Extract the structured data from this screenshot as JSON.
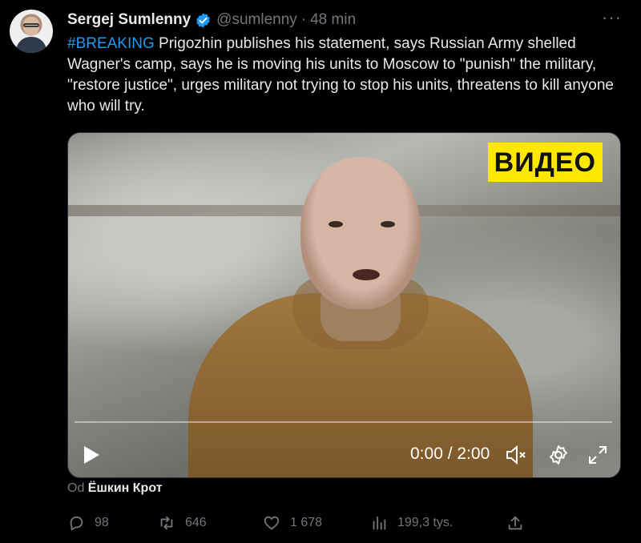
{
  "author": {
    "display_name": "Sergej Sumlenny",
    "handle": "@sumlenny",
    "separator": "·",
    "time": "48 min"
  },
  "more_menu": "···",
  "tweet": {
    "hashtag": "#BREAKING",
    "text": " Prigozhin publishes his statement, says Russian Army shelled Wagner's camp, says he is moving his units to Moscow to \"punish\" the military, \"restore justice\", urges military not trying to stop his units, threatens to kill anyone who will try."
  },
  "video": {
    "badge": "ВИДЕО",
    "timecode": "0:00 / 2:00",
    "progress_fraction": 0.0
  },
  "attribution": {
    "prefix": "Od",
    "source_name": "Ёшкин Крот"
  },
  "actions": {
    "replies": "98",
    "retweets": "646",
    "likes": "1 678",
    "views": "199,3 tys."
  },
  "colors": {
    "background": "#000000",
    "text": "#e7e9ea",
    "muted": "#71767b",
    "link": "#1d9bf0",
    "badge": "#ffe800"
  },
  "icons": [
    "verified-icon",
    "more-icon",
    "play-icon",
    "mute-icon",
    "settings-icon",
    "fullscreen-icon",
    "reply-icon",
    "retweet-icon",
    "like-icon",
    "views-icon",
    "share-icon"
  ]
}
